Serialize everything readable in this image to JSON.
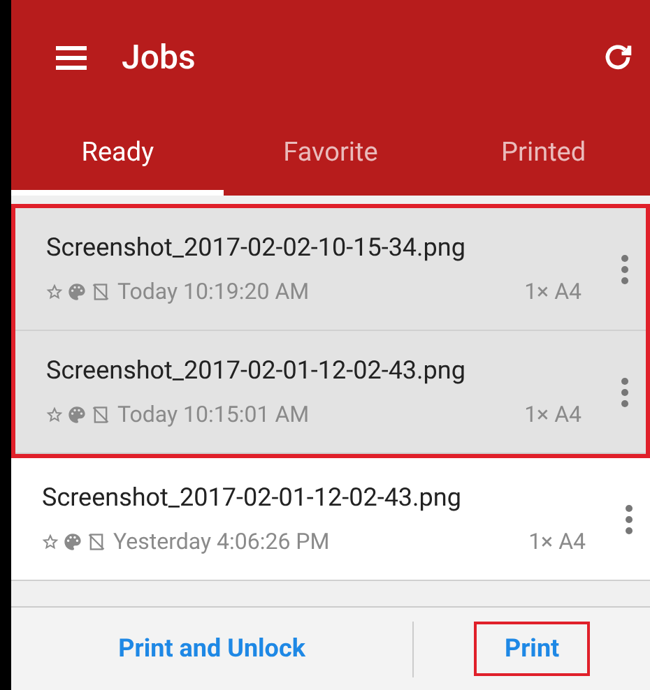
{
  "app_bar": {
    "title": "Jobs"
  },
  "tabs": [
    {
      "label": "Ready",
      "selected": true
    },
    {
      "label": "Favorite",
      "selected": false
    },
    {
      "label": "Printed",
      "selected": false
    }
  ],
  "jobs": [
    {
      "name": "Screenshot_2017-02-02-10-15-34.png",
      "time": "Today 10:19:20 AM",
      "copies": "1× A4",
      "selected": true
    },
    {
      "name": "Screenshot_2017-02-01-12-02-43.png",
      "time": "Today 10:15:01 AM",
      "copies": "1× A4",
      "selected": true
    },
    {
      "name": "Screenshot_2017-02-01-12-02-43.png",
      "time": "Yesterday 4:06:26 PM",
      "copies": "1× A4",
      "selected": false
    }
  ],
  "actions": [
    {
      "label": "Print and Unlock",
      "outlined": false
    },
    {
      "label": "Print",
      "outlined": true
    }
  ]
}
